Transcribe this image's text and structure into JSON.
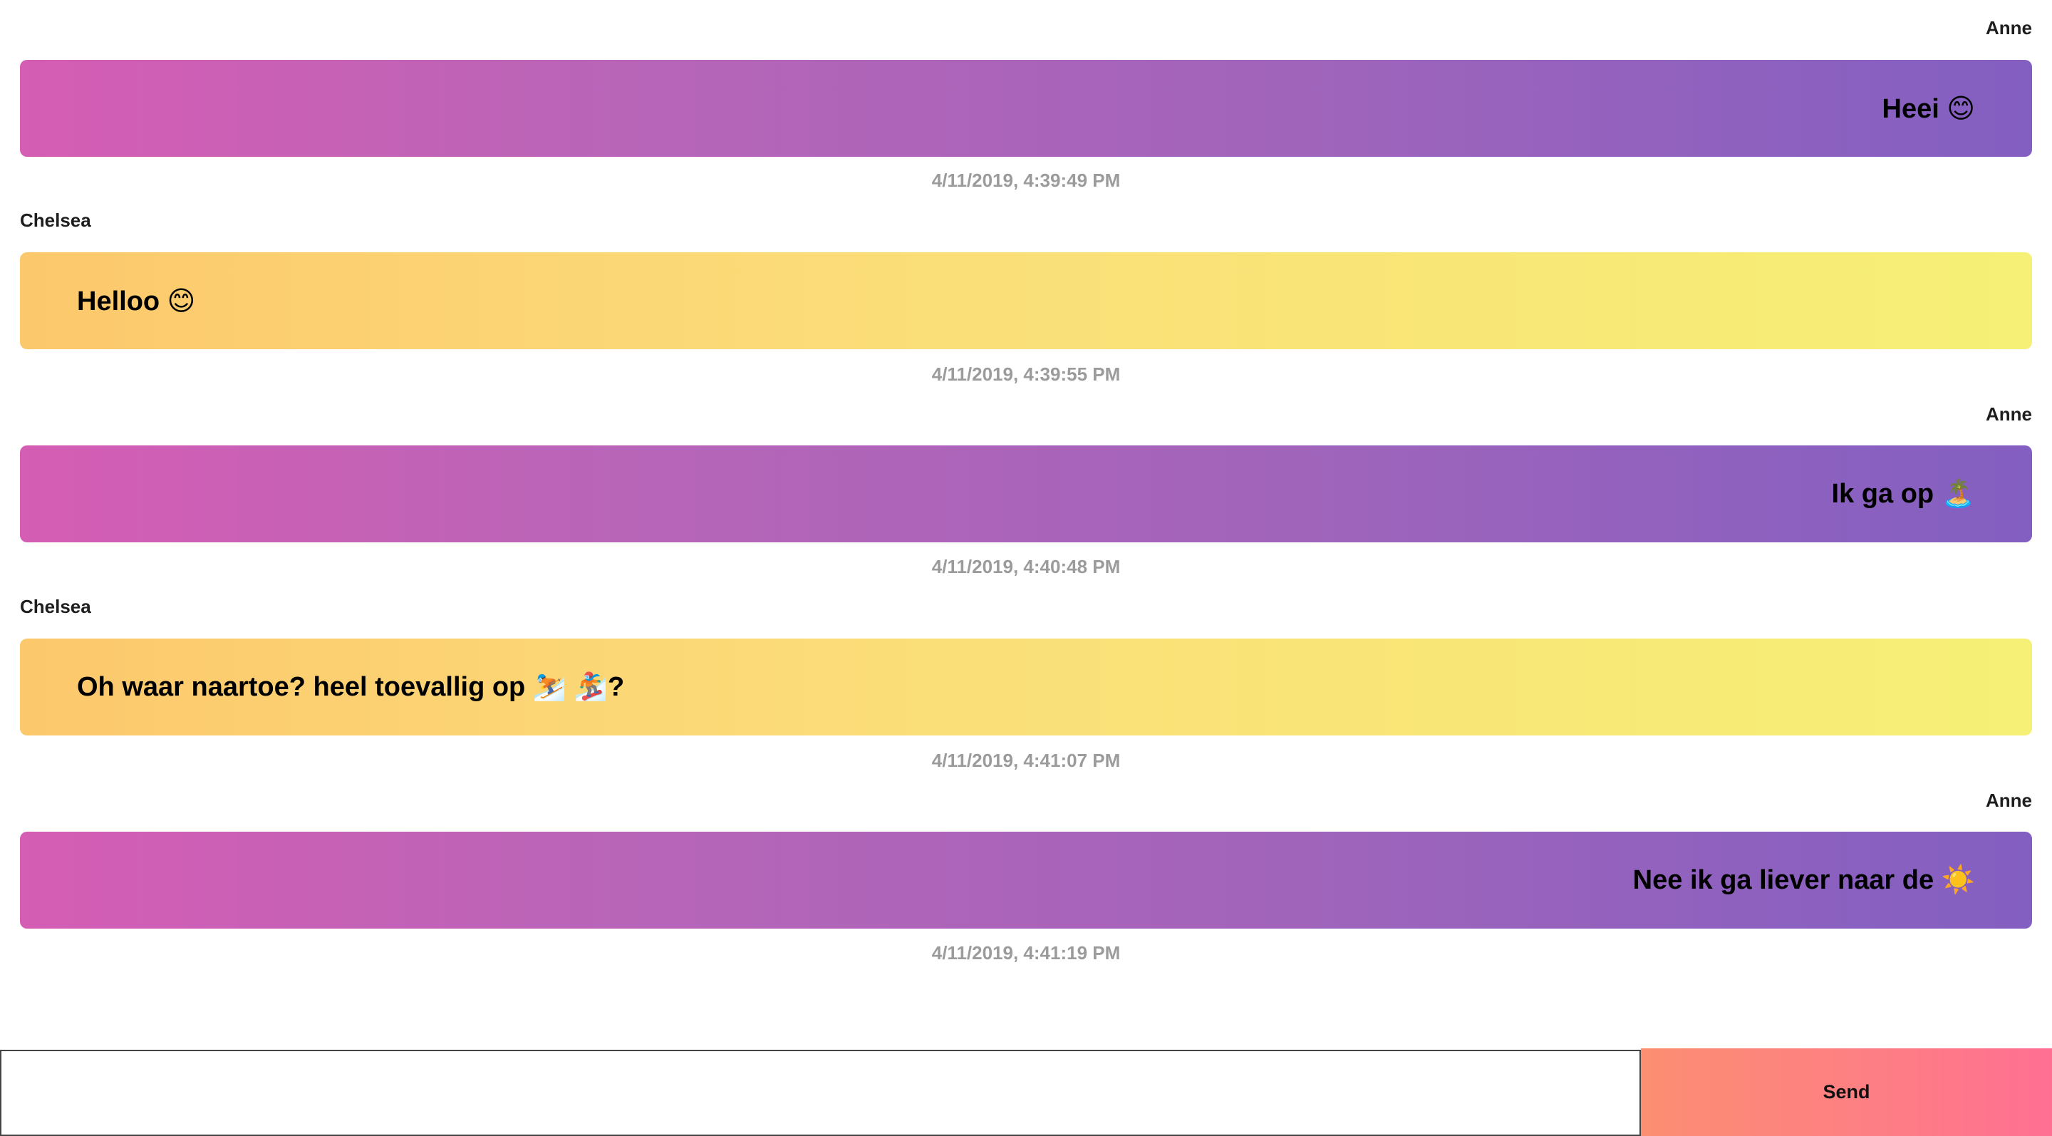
{
  "messages": [
    {
      "sender": "Anne",
      "text": "Heei 😊",
      "timestamp": "4/11/2019, 4:39:49 PM",
      "side": "right"
    },
    {
      "sender": "Chelsea",
      "text": "Helloo 😊",
      "timestamp": "4/11/2019, 4:39:55 PM",
      "side": "left"
    },
    {
      "sender": "Anne",
      "text": "Ik ga op 🏝️",
      "timestamp": "4/11/2019, 4:40:48 PM",
      "side": "right"
    },
    {
      "sender": "Chelsea",
      "text": "Oh waar naartoe? heel toevallig op ⛷️ 🏂?",
      "timestamp": "4/11/2019, 4:41:07 PM",
      "side": "left"
    },
    {
      "sender": "Anne",
      "text": "Nee ik ga liever naar de ☀️",
      "timestamp": "4/11/2019, 4:41:19 PM",
      "side": "right"
    }
  ],
  "composer": {
    "input_value": "",
    "input_placeholder": "",
    "send_label": "Send"
  },
  "colors": {
    "own_bubble_gradient": [
      "#d55db4",
      "#835fc1"
    ],
    "other_bubble_gradient": [
      "#fcc86c",
      "#f6f076"
    ],
    "send_button_gradient": [
      "#fc8e72",
      "#ff6f92"
    ],
    "timestamp": "#9b9b9b"
  }
}
